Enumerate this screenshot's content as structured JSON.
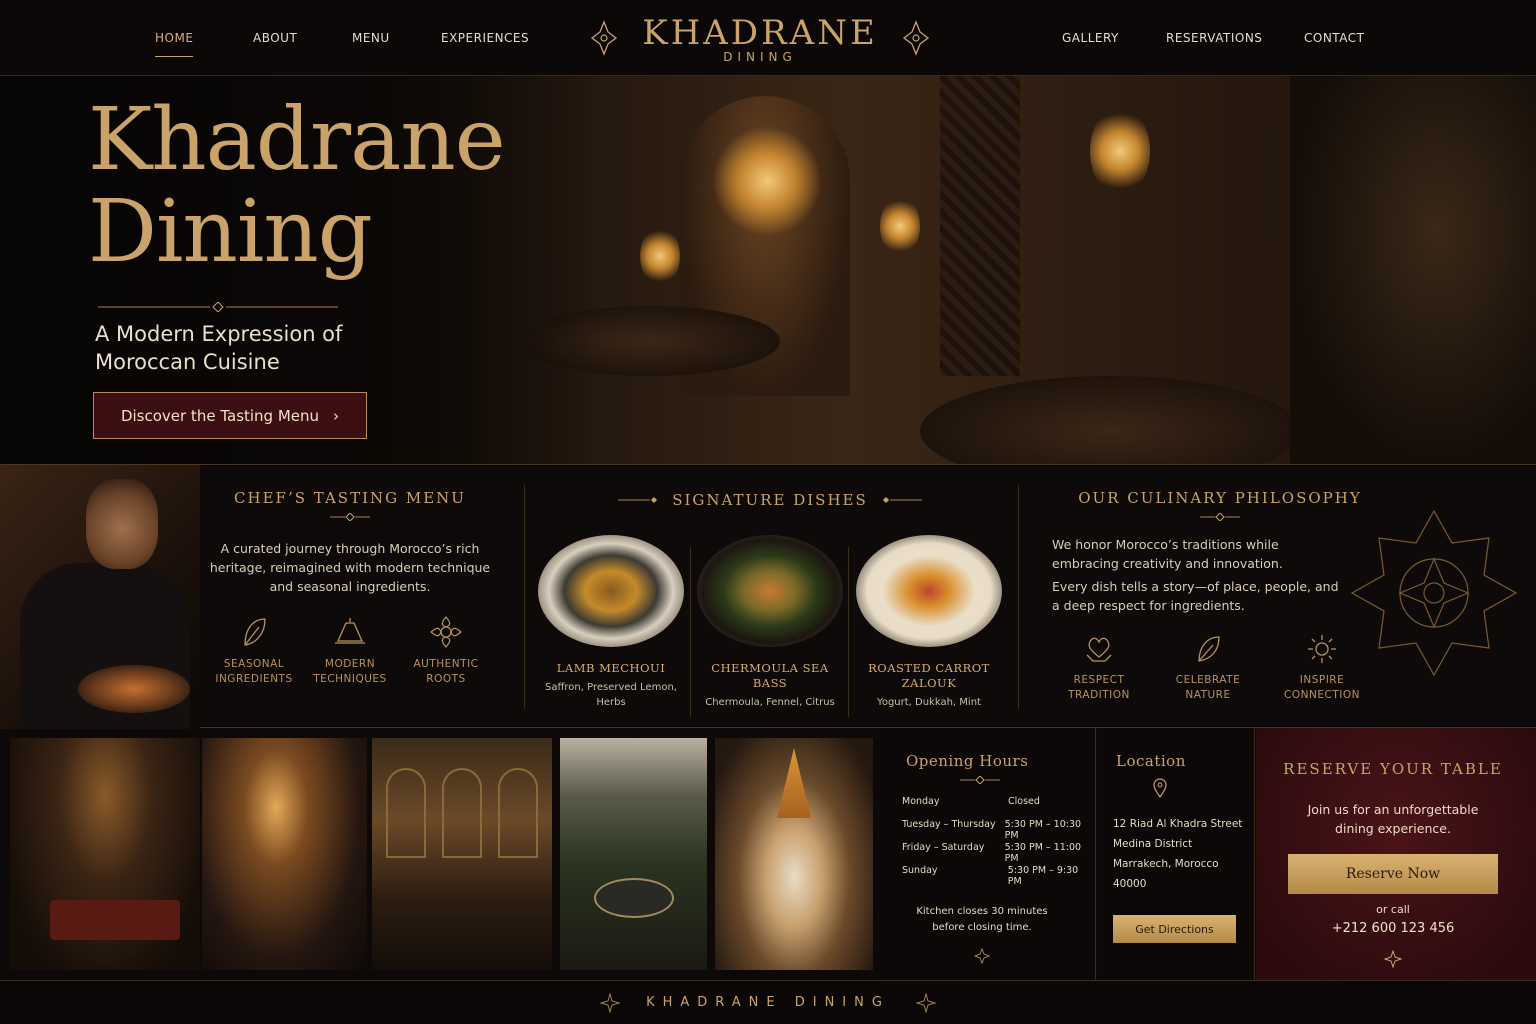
{
  "nav": {
    "left": [
      "HOME",
      "ABOUT",
      "MENU",
      "EXPERIENCES"
    ],
    "right": [
      "GALLERY",
      "RESERVATIONS",
      "CONTACT"
    ],
    "brand_name": "KHADRANE",
    "brand_sub": "DINING"
  },
  "hero": {
    "title_line1": "Khadrane",
    "title_line2": "Dining",
    "subtitle_line1": "A Modern Expression of",
    "subtitle_line2": "Moroccan Cuisine",
    "cta": "Discover the Tasting Menu",
    "cta_arrow": "›"
  },
  "tasting": {
    "title": "CHEF’S TASTING MENU",
    "text": "A curated journey through Morocco’s rich heritage, reimagined with modern technique and seasonal ingredients.",
    "features": [
      {
        "line1": "SEASONAL",
        "line2": "INGREDIENTS"
      },
      {
        "line1": "MODERN",
        "line2": "TECHNIQUES"
      },
      {
        "line1": "AUTHENTIC",
        "line2": "ROOTS"
      }
    ]
  },
  "signature": {
    "title": "SIGNATURE DISHES",
    "dishes": [
      {
        "name": "LAMB MECHOUI",
        "desc": "Saffron, Preserved Lemon, Herbs"
      },
      {
        "name": "CHERMOULA SEA BASS",
        "desc": "Chermoula, Fennel, Citrus"
      },
      {
        "name": "ROASTED CARROT ZALOUK",
        "desc": "Yogurt, Dukkah, Mint"
      }
    ]
  },
  "philosophy": {
    "title": "OUR CULINARY PHILOSOPHY",
    "p1": "We honor Morocco’s traditions while embracing creativity and innovation.",
    "p2": "Every dish tells a story—of place, people, and a deep respect for ingredients.",
    "values": [
      {
        "line1": "RESPECT",
        "line2": "TRADITION"
      },
      {
        "line1": "CELEBRATE",
        "line2": "NATURE"
      },
      {
        "line1": "INSPIRE",
        "line2": "CONNECTION"
      }
    ]
  },
  "hours": {
    "title": "Opening Hours",
    "rows": [
      {
        "day": "Monday",
        "time": "Closed"
      },
      {
        "day": "Tuesday – Thursday",
        "time": "5:30 PM – 10:30 PM"
      },
      {
        "day": "Friday – Saturday",
        "time": "5:30 PM – 11:00 PM"
      },
      {
        "day": "Sunday",
        "time": "5:30 PM – 9:30 PM"
      }
    ],
    "note": "Kitchen closes 30 minutes before closing time."
  },
  "location": {
    "title": "Location",
    "lines": [
      "12 Riad Al Khadra Street",
      "Medina District",
      "Marrakech, Morocco",
      "40000"
    ],
    "button": "Get Directions"
  },
  "reserve": {
    "title": "RESERVE YOUR TABLE",
    "text": "Join us for an unforgettable dining experience.",
    "button": "Reserve Now",
    "or_call": "or call",
    "phone": "+212 600 123 456"
  },
  "footer": {
    "text": "KHADRANE DINING"
  },
  "colors": {
    "gold": "#c9a46a",
    "burgundy": "#3e0f12",
    "background": "#0c0908"
  }
}
